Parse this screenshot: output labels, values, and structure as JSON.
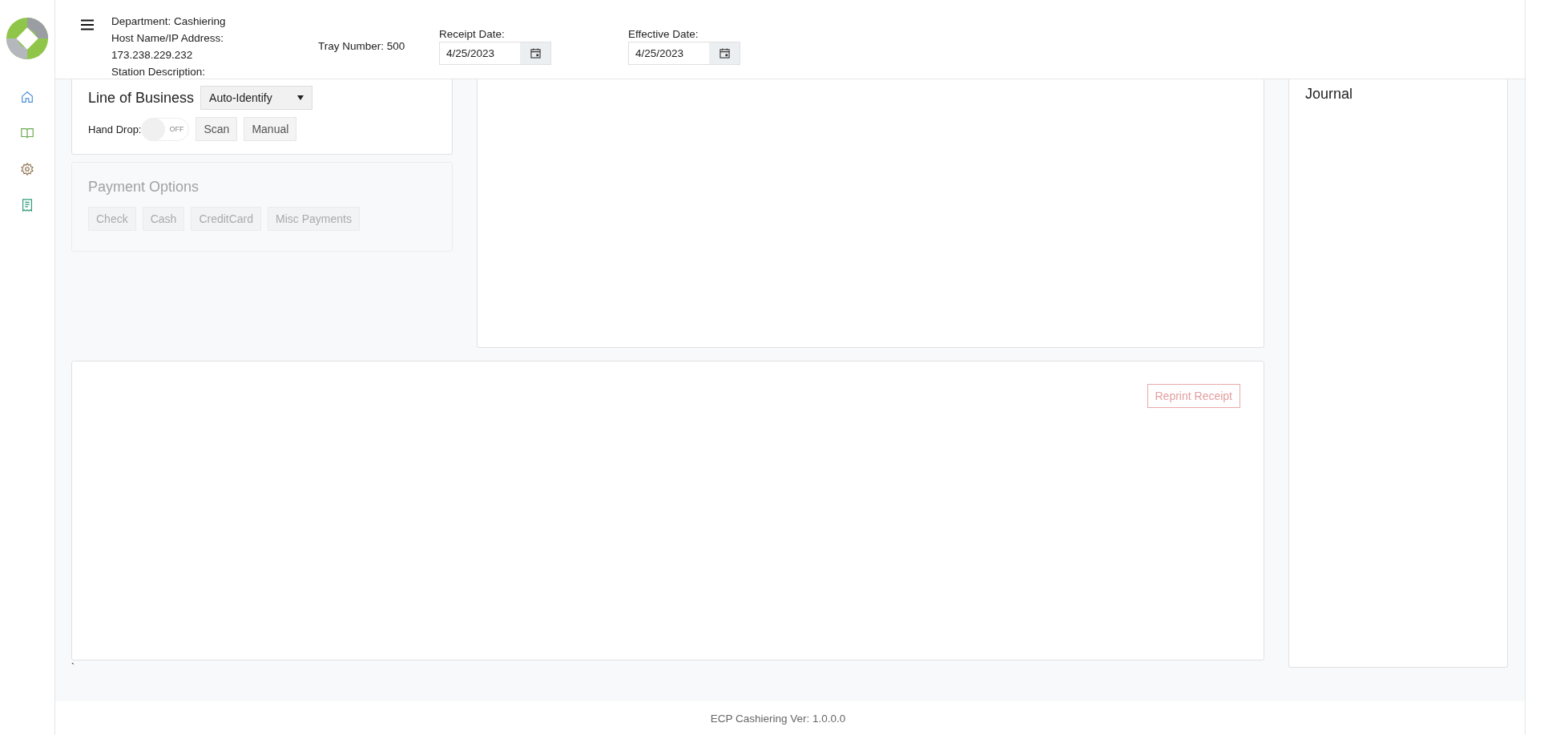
{
  "header": {
    "department": "Department: Cashiering",
    "host_label": "Host Name/IP Address:",
    "host_ip": "173.238.229.232",
    "station": "Station Description:",
    "tray": "Tray Number: 500",
    "dates": [
      {
        "label": "Receipt Date:",
        "value": "4/25/2023"
      },
      {
        "label": "Effective Date:",
        "value": "4/25/2023"
      }
    ]
  },
  "line_of_business": {
    "title": "Line of Business",
    "select": "Auto-Identify",
    "hand_drop": {
      "label": "Hand Drop:",
      "on": false,
      "state_text": "OFF"
    },
    "buttons": [
      "Scan",
      "Manual"
    ]
  },
  "payment_options": {
    "title": "Payment Options",
    "disabled": true,
    "buttons": [
      "Check",
      "Cash",
      "CreditCard",
      "Misc Payments"
    ]
  },
  "receipt_panel": {
    "button": {
      "label": "Reprint Receipt",
      "disabled": true
    }
  },
  "note": "`",
  "journal": {
    "title": "Journal"
  },
  "footer": "ECP Cashiering Ver: 1.0.0.0"
}
